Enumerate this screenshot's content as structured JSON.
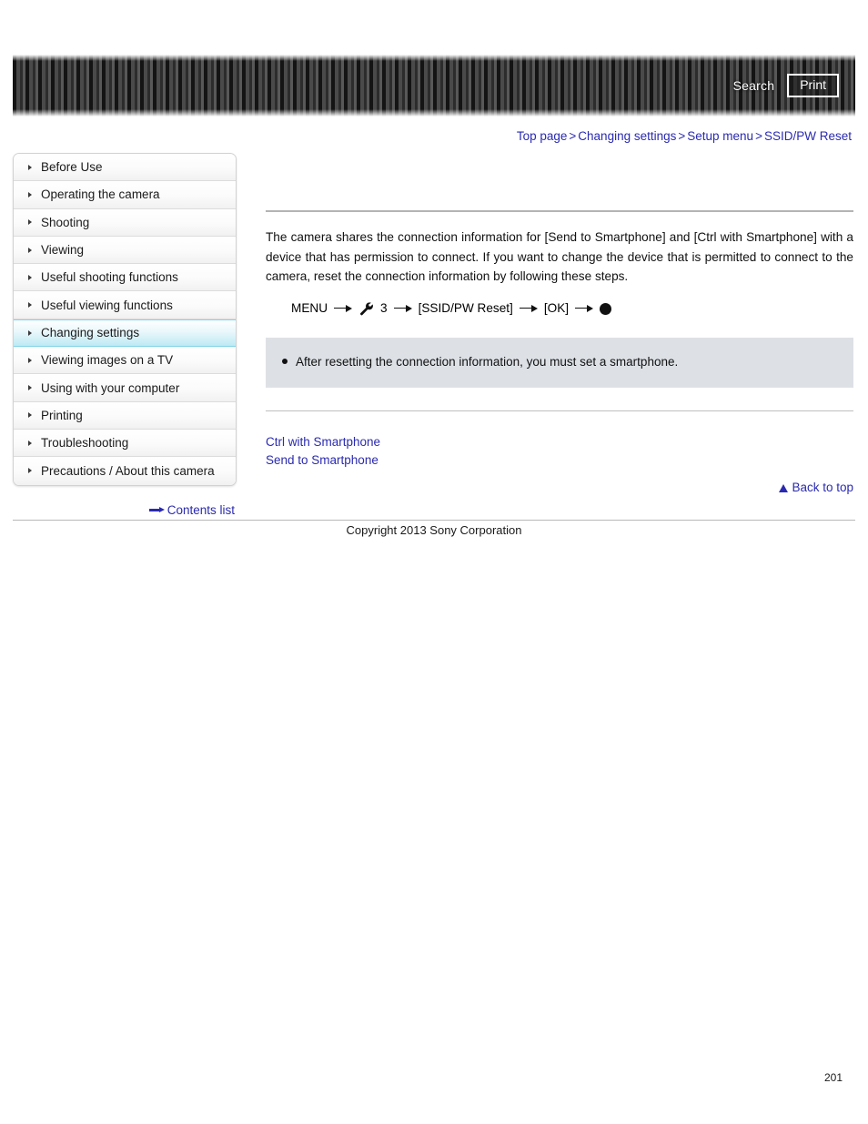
{
  "header": {
    "search_label": "Search",
    "print_label": "Print"
  },
  "breadcrumb": {
    "items": [
      {
        "label": "Top page"
      },
      {
        "label": "Changing settings"
      },
      {
        "label": "Setup menu"
      },
      {
        "label": "SSID/PW Reset"
      }
    ],
    "separator": ">"
  },
  "sidebar": {
    "items": [
      {
        "label": "Before Use",
        "active": false
      },
      {
        "label": "Operating the camera",
        "active": false
      },
      {
        "label": "Shooting",
        "active": false
      },
      {
        "label": "Viewing",
        "active": false
      },
      {
        "label": "Useful shooting functions",
        "active": false
      },
      {
        "label": "Useful viewing functions",
        "active": false
      },
      {
        "label": "Changing settings",
        "active": true
      },
      {
        "label": "Viewing images on a TV",
        "active": false
      },
      {
        "label": "Using with your computer",
        "active": false
      },
      {
        "label": "Printing",
        "active": false
      },
      {
        "label": "Troubleshooting",
        "active": false
      },
      {
        "label": "Precautions / About this camera",
        "active": false
      }
    ],
    "contents_list_label": "Contents list"
  },
  "main": {
    "paragraph": "The camera shares the connection information for [Send to Smartphone] and [Ctrl with Smartphone] with a device that has permission to connect. If you want to change the device that is permitted to connect to the camera, reset the connection information by following these steps.",
    "menu_path": {
      "step1": "MENU",
      "step2_icon": "wrench-icon",
      "step2": "3",
      "step3": "[SSID/PW Reset]",
      "step4": "[OK]",
      "step5_icon": "filled-circle-icon"
    },
    "note": {
      "text": "After resetting the connection information, you must set a smartphone."
    },
    "related_links": [
      {
        "label": "Ctrl with Smartphone"
      },
      {
        "label": "Send to Smartphone"
      }
    ],
    "back_to_top_label": "Back to top"
  },
  "footer": {
    "copyright": "Copyright 2013 Sony Corporation",
    "page_number": "201"
  },
  "colors": {
    "link": "#2a2ab0",
    "note_bg": "#dde1e6",
    "active_nav": "#bdeaf4"
  }
}
